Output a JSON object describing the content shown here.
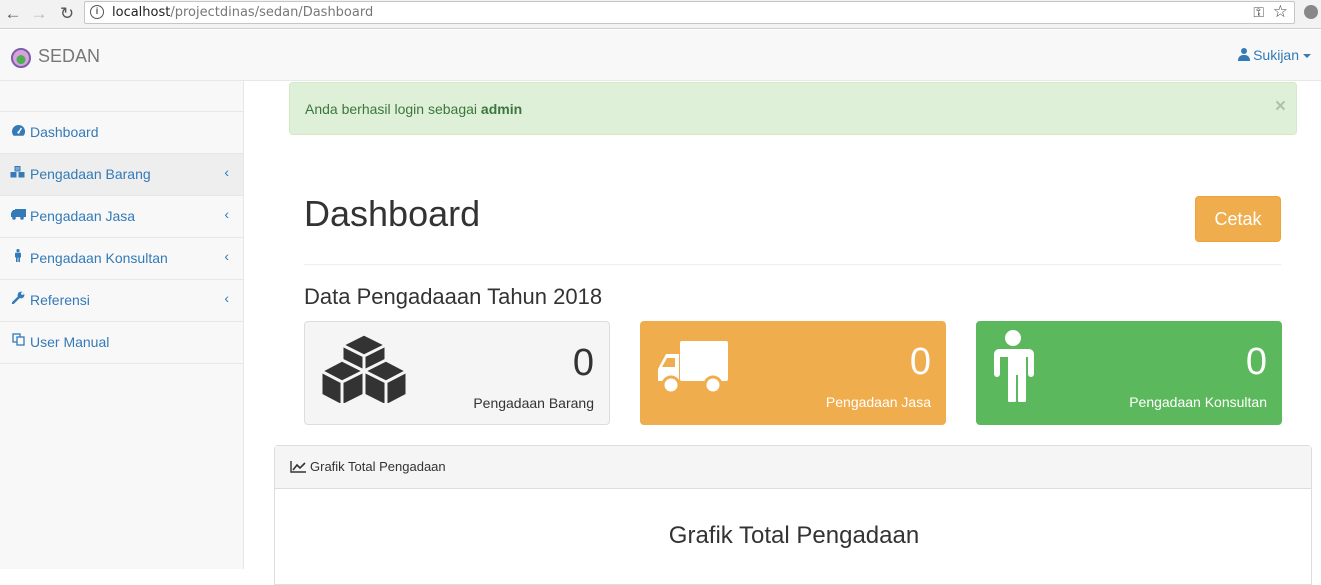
{
  "browser": {
    "url_host": "localhost",
    "url_path": "/projectdinas/sedan/Dashboard"
  },
  "navbar": {
    "brand": "SEDAN",
    "user": "Sukijan"
  },
  "sidebar": {
    "items": [
      {
        "label": "Dashboard",
        "icon": "dashboard-icon"
      },
      {
        "label": "Pengadaan Barang",
        "icon": "cubes-icon"
      },
      {
        "label": "Pengadaan Jasa",
        "icon": "truck-icon"
      },
      {
        "label": "Pengadaan Konsultan",
        "icon": "male-icon"
      },
      {
        "label": "Referensi",
        "icon": "wrench-icon"
      },
      {
        "label": "User Manual",
        "icon": "copy-icon"
      }
    ]
  },
  "alert": {
    "text": "Anda berhasil login sebagai ",
    "role": "admin",
    "close": "×"
  },
  "page": {
    "title": "Dashboard",
    "print_button": "Cetak",
    "section_title": "Data Pengadaaan Tahun 2018"
  },
  "stats": [
    {
      "count": "0",
      "label": "Pengadaan Barang"
    },
    {
      "count": "0",
      "label": "Pengadaan Jasa"
    },
    {
      "count": "0",
      "label": "Pengadaan Konsultan"
    }
  ],
  "chart_panel": {
    "heading": "Grafik Total Pengadaan",
    "chart_title": "Grafik Total Pengadaan"
  },
  "colors": {
    "warning": "#f0ad4e",
    "success": "#5cb85c",
    "link": "#337ab7",
    "alert_bg": "#dff0d8"
  }
}
